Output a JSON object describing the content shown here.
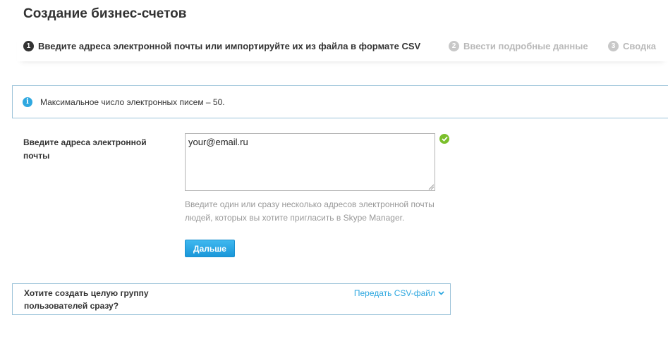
{
  "page": {
    "title": "Создание бизнес-счетов"
  },
  "steps": [
    {
      "number": "1",
      "label": "Введите адреса электронной почты или импортируйте их из файла в формате CSV",
      "state": "active"
    },
    {
      "number": "2",
      "label": "Ввести подробные данные",
      "state": "inactive"
    },
    {
      "number": "3",
      "label": "Сводка",
      "state": "inactive"
    }
  ],
  "info": {
    "icon": "info-icon",
    "text": "Максимальное число электронных писем – 50."
  },
  "form": {
    "email_label": "Введите адреса электронной почты",
    "email_value": "your@email.ru",
    "valid_icon": "check-circle-icon",
    "hint": "Введите один или сразу несколько адресов электронной почты людей, которых вы хотите пригласить в Skype Manager.",
    "next_label": "Дальше"
  },
  "csv": {
    "question": "Хотите создать целую группу пользователей сразу?",
    "link_label": "Передать CSV-файл",
    "link_icon": "chevron-down-icon"
  },
  "colors": {
    "accent": "#2fa8e0",
    "border": "#9cc3d9",
    "valid": "#7bbf2b"
  }
}
